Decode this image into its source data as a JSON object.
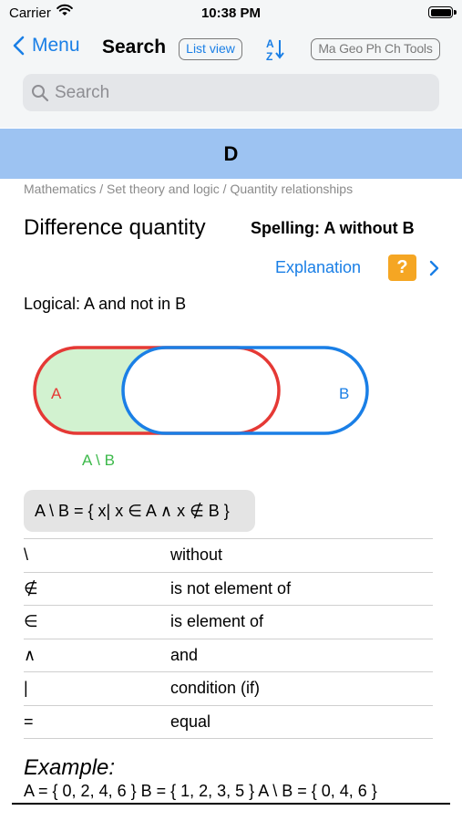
{
  "status_bar": {
    "carrier": "Carrier",
    "time": "10:38 PM"
  },
  "nav": {
    "back_label": "Menu",
    "title": "Search",
    "list_view_label": "List view",
    "tools_label": "Ma Geo Ph Ch Tools",
    "sort_icon": "sort-az-icon"
  },
  "search": {
    "placeholder": "Search"
  },
  "section": {
    "letter": "D"
  },
  "entry": {
    "breadcrumb": "Mathematics / Set theory and logic / Quantity relationships",
    "term": "Difference quantity",
    "spelling": "Spelling: A without B",
    "explanation_label": "Explanation",
    "help_label": "?",
    "logical": "Logical: A and not in B"
  },
  "venn": {
    "label_a": "A",
    "label_b": "B",
    "label_diff": "A \\ B",
    "colors": {
      "a": "#e53935",
      "b": "#1a7fe6",
      "fill": "#d2f2d0",
      "diff": "#3cb94a"
    }
  },
  "formula": "A \\ B = { x| x ∈ A ∧ x ∉ B }",
  "symbols": [
    {
      "symbol": "\\",
      "meaning": "without"
    },
    {
      "symbol": "∉",
      "meaning": "is not element of"
    },
    {
      "symbol": "∈",
      "meaning": "is element of"
    },
    {
      "symbol": "∧",
      "meaning": "and"
    },
    {
      "symbol": "|",
      "meaning": "condition (if)"
    },
    {
      "symbol": "=",
      "meaning": "equal"
    }
  ],
  "example": {
    "label": "Example:",
    "text": "A = { 0, 2, 4, 6 }  B = { 1, 2, 3, 5 }  A \\ B = { 0, 4, 6 }"
  },
  "colors": {
    "accent": "#1a7fe6",
    "header_band": "#9dc3f2",
    "help_button": "#f5a623"
  }
}
